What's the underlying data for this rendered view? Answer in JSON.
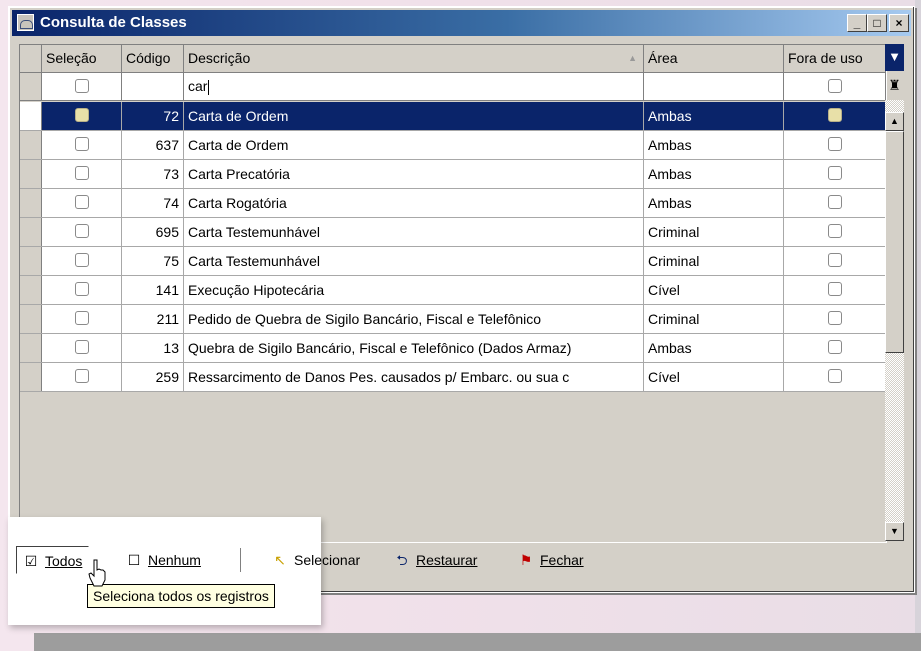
{
  "window": {
    "title": "Consulta de Classes",
    "minimize": "_",
    "maximize": "□",
    "close": "×"
  },
  "grid": {
    "columns": [
      "Seleção",
      "Código",
      "Descrição",
      "Área",
      "Fora de uso"
    ],
    "filter": {
      "descricao": "car"
    },
    "rows": [
      {
        "codigo": "72",
        "descricao": "Carta de Ordem",
        "area": "Ambas"
      },
      {
        "codigo": "637",
        "descricao": "Carta de Ordem",
        "area": "Ambas"
      },
      {
        "codigo": "73",
        "descricao": "Carta Precatória",
        "area": "Ambas"
      },
      {
        "codigo": "74",
        "descricao": "Carta Rogatória",
        "area": "Ambas"
      },
      {
        "codigo": "695",
        "descricao": "Carta Testemunhável",
        "area": "Criminal"
      },
      {
        "codigo": "75",
        "descricao": "Carta Testemunhável",
        "area": "Criminal"
      },
      {
        "codigo": "141",
        "descricao": "Execução Hipotecária",
        "area": "Cível"
      },
      {
        "codigo": "211",
        "descricao": "Pedido de Quebra de Sigilo Bancário, Fiscal e Telefônico",
        "area": "Criminal"
      },
      {
        "codigo": "13",
        "descricao": "Quebra de Sigilo Bancário, Fiscal e Telefônico (Dados Armaz)",
        "area": "Ambas"
      },
      {
        "codigo": "259",
        "descricao": "Ressarcimento de Danos Pes. causados p/ Embarc. ou sua c",
        "area": "Cível"
      }
    ],
    "selected_row": 0
  },
  "toolbar": {
    "todos": "Todos",
    "nenhum": "Nenhum",
    "selecionar": "Selecionar",
    "restaurar": "Restaurar",
    "fechar": "Fechar"
  },
  "tooltip": "Seleciona todos os registros",
  "colors": {
    "selection": "#0a246a",
    "window_face": "#d4d0c8",
    "tooltip_bg": "#ffffe1"
  },
  "icons": {
    "filter": "funnel-icon",
    "clear": "brush-icon",
    "todos": "check-all-icon",
    "nenhum": "uncheck-all-icon",
    "selecionar": "select-arrow-icon",
    "restaurar": "restore-icon",
    "fechar": "close-sign-icon"
  }
}
